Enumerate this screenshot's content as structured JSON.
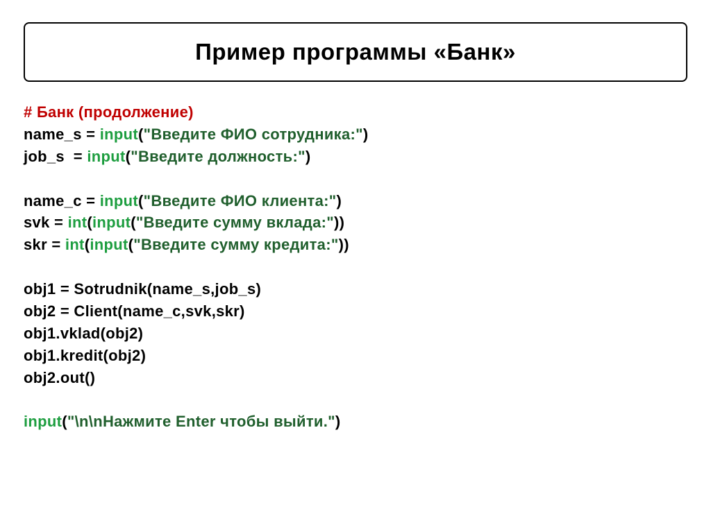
{
  "title": "Пример программы «Банк»",
  "code": {
    "comment": "# Банк (продолжение)",
    "l1_a": "name_s = ",
    "l1_fn": "input",
    "l1_b": "(",
    "l1_str": "\"Введите ФИО сотрудника:\"",
    "l1_c": ")",
    "l2_a": "job_s  = ",
    "l2_fn": "input",
    "l2_b": "(",
    "l2_str": "\"Введите должность:\"",
    "l2_c": ")",
    "l3_a": "name_c = ",
    "l3_fn": "input",
    "l3_b": "(",
    "l3_str": "\"Введите ФИО клиента:\"",
    "l3_c": ")",
    "l4_a": "svk = ",
    "l4_fn1": "int",
    "l4_b": "(",
    "l4_fn2": "input",
    "l4_c": "(",
    "l4_str": "\"Введите сумму вклада:\"",
    "l4_d": "))",
    "l5_a": "skr = ",
    "l5_fn1": "int",
    "l5_b": "(",
    "l5_fn2": "input",
    "l5_c": "(",
    "l5_str": "\"Введите сумму кредита:\"",
    "l5_d": "))",
    "l6": "obj1 = Sotrudnik(name_s,job_s)",
    "l7": "obj2 = Client(name_c,svk,skr)",
    "l8": "obj1.vklad(obj2)",
    "l9": "obj1.kredit(obj2)",
    "l10": "obj2.out()",
    "l11_fn": "input",
    "l11_b": "(",
    "l11_str": "\"\\n\\nНажмите Enter чтобы выйти.\"",
    "l11_c": ")"
  }
}
